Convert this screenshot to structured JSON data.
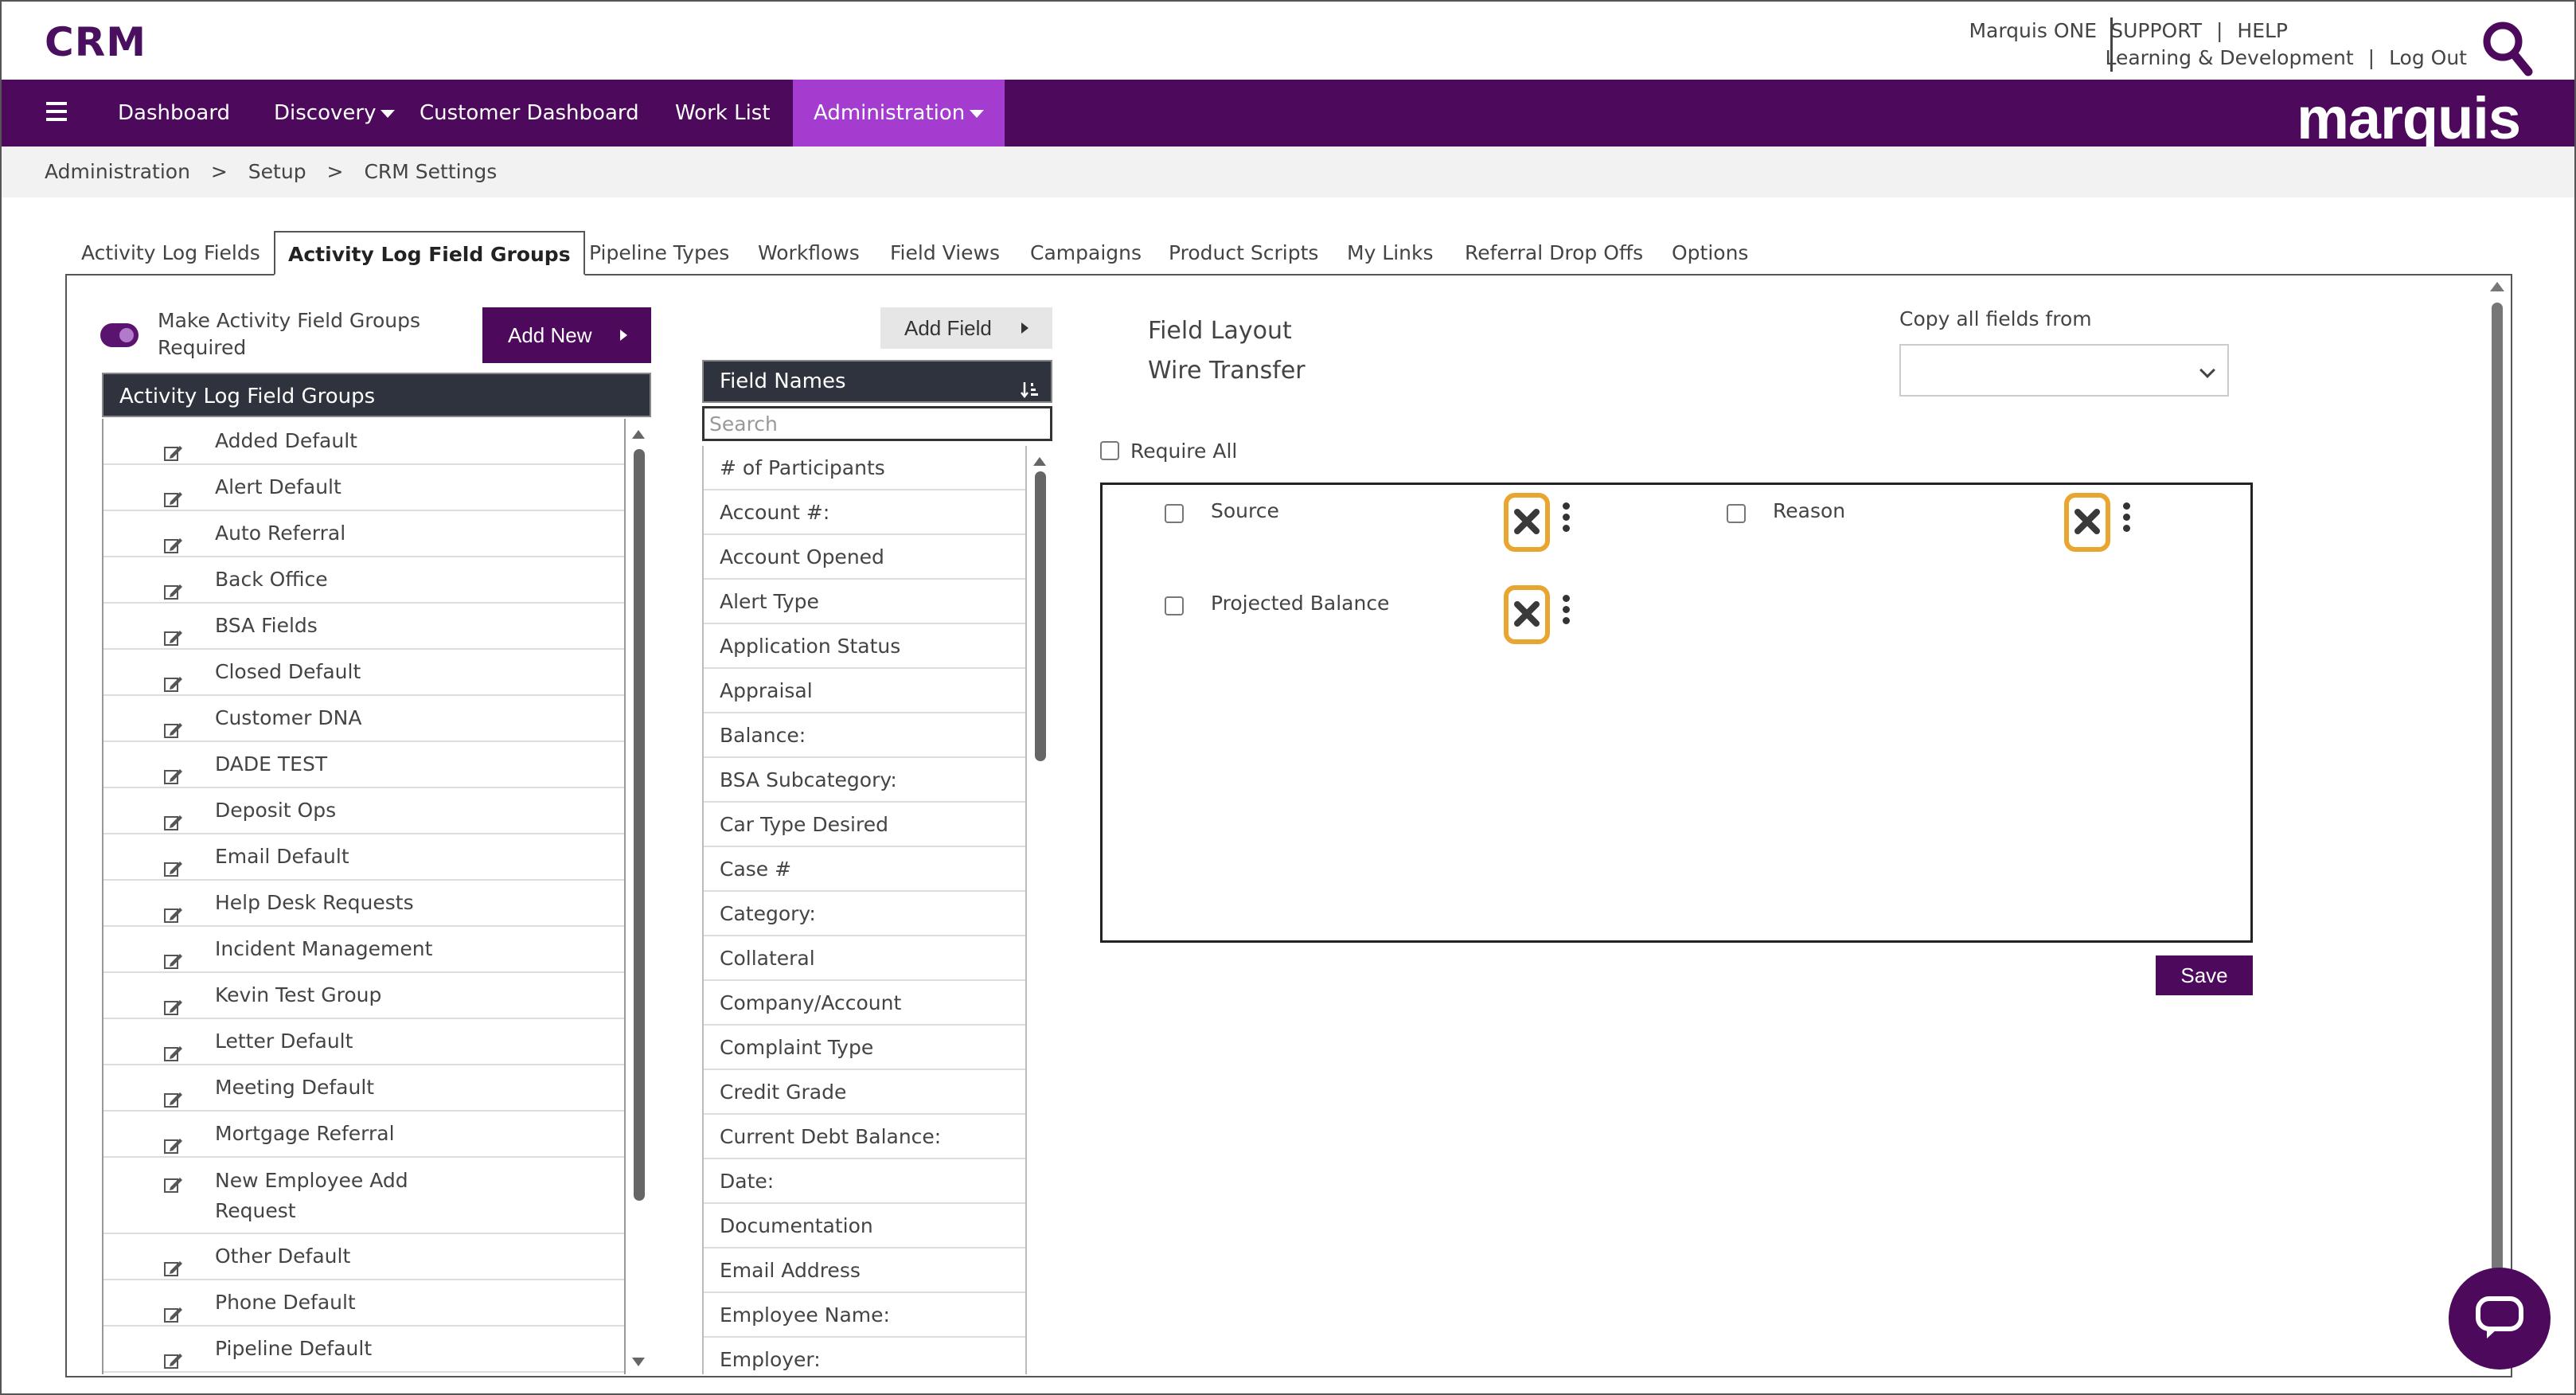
{
  "header": {
    "app_title": "CRM",
    "marquis_one": "Marquis ONE",
    "support": "SUPPORT",
    "help": "HELP",
    "learning": "Learning & Development",
    "logout": "Log Out",
    "pipe": "|"
  },
  "nav": {
    "items": [
      "Dashboard",
      "Discovery",
      "Customer Dashboard",
      "Work List",
      "Administration"
    ],
    "brand": "marquis"
  },
  "breadcrumb": [
    "Administration",
    "Setup",
    "CRM Settings"
  ],
  "breadcrumb_sep": ">",
  "tabs": [
    "Activity Log Fields",
    "Activity Log Field Groups",
    "Pipeline Types",
    "Workflows",
    "Field Views",
    "Campaigns",
    "Product Scripts",
    "My Links",
    "Referral Drop Offs",
    "Options"
  ],
  "active_tab": "Activity Log Field Groups",
  "left": {
    "toggle_label": "Make Activity Field Groups Required",
    "add_new": "Add New",
    "groups_header": "Activity Log Field Groups",
    "groups": [
      "Added Default",
      "Alert Default",
      "Auto Referral",
      "Back Office",
      "BSA Fields",
      "Closed Default",
      "Customer DNA",
      "DADE TEST",
      "Deposit Ops",
      "Email Default",
      "Help Desk Requests",
      "Incident Management",
      "Kevin Test Group",
      "Letter Default",
      "Meeting Default",
      "Mortgage Referral",
      "New Employee Add Request",
      "Other Default",
      "Phone Default",
      "Pipeline Default"
    ]
  },
  "middle": {
    "add_field": "Add Field",
    "field_names_header": "Field Names",
    "search_placeholder": "Search",
    "fields": [
      "# of Participants",
      "Account #:",
      "Account Opened",
      "Alert Type",
      "Application Status",
      "Appraisal",
      "Balance:",
      "BSA Subcategory:",
      "Car Type Desired",
      "Case #",
      "Category:",
      "Collateral",
      "Company/Account",
      "Complaint Type",
      "Credit Grade",
      "Current Debt Balance:",
      "Date:",
      "Documentation",
      "Email Address",
      "Employee Name:",
      "Employer:"
    ]
  },
  "right": {
    "layout_title": "Field Layout",
    "layout_name": "Wire Transfer",
    "copy_label": "Copy all fields from",
    "copy_value": "",
    "require_all": "Require All",
    "layout_fields": [
      "Source",
      "Reason",
      "Projected Balance"
    ],
    "save": "Save"
  },
  "colors": {
    "brand_purple": "#4d0a5c",
    "active_nav": "#a33ccf",
    "highlight": "#e8a630"
  }
}
